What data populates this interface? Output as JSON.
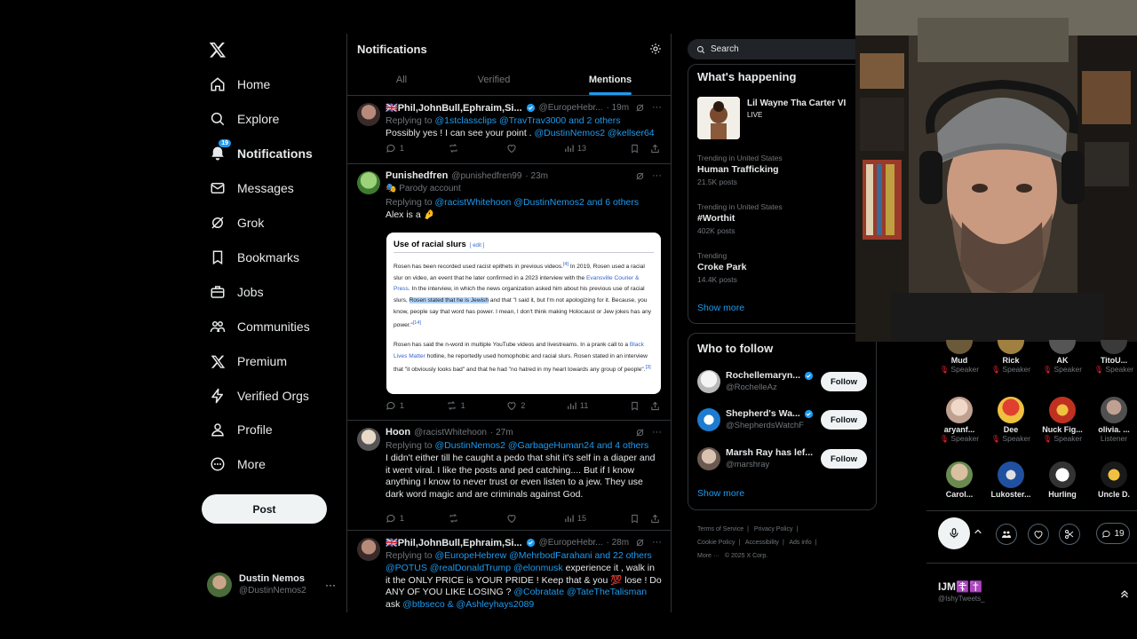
{
  "nav": {
    "items": [
      {
        "label": "Home",
        "icon": "home-icon"
      },
      {
        "label": "Explore",
        "icon": "search-icon"
      },
      {
        "label": "Notifications",
        "icon": "bell-icon",
        "badge": "19"
      },
      {
        "label": "Messages",
        "icon": "mail-icon"
      },
      {
        "label": "Grok",
        "icon": "grok-icon"
      },
      {
        "label": "Bookmarks",
        "icon": "bookmark-icon"
      },
      {
        "label": "Jobs",
        "icon": "briefcase-icon"
      },
      {
        "label": "Communities",
        "icon": "people-icon"
      },
      {
        "label": "Premium",
        "icon": "x-logo-icon"
      },
      {
        "label": "Verified Orgs",
        "icon": "lightning-icon"
      },
      {
        "label": "Profile",
        "icon": "person-icon"
      },
      {
        "label": "More",
        "icon": "more-circle-icon"
      }
    ],
    "post_label": "Post",
    "account": {
      "name": "Dustin Nemos",
      "handle": "@DustinNemos2"
    }
  },
  "center": {
    "title": "Notifications",
    "tabs": [
      "All",
      "Verified",
      "Mentions"
    ],
    "tweets": [
      {
        "name": "🇬🇧Phil,JohnBull,Ephraim,Si...",
        "handle": "@EuropeHebr...",
        "time": "· 19m",
        "replying_prefix": "Replying to",
        "replying_users": "@1stclassclips @TravTrav3000",
        "replying_suffix": "and 2 others",
        "text": "Possibly yes ! I can see your point .",
        "text_mentions": "@DustinNemos2 @kellser64",
        "replies": "1",
        "retweets": "",
        "likes": "",
        "views": "13"
      },
      {
        "name": "Punishedfren",
        "handle": "@punishedfren99",
        "time": "· 23m",
        "badge_label": "Parody account",
        "replying_prefix": "Replying to",
        "replying_users": "@racistWhitehoon @DustinNemos2",
        "replying_suffix": "and 6 others",
        "text": "Alex is a 🤌",
        "replies": "1",
        "retweets": "1",
        "likes": "2",
        "views": "11"
      },
      {
        "name": "Hoon",
        "handle": "@racistWhitehoon",
        "time": "· 27m",
        "replying_prefix": "Replying to",
        "replying_users": "@DustinNemos2 @GarbageHuman24",
        "replying_suffix": "and 4 others",
        "text": "I didn't either till he caught a pedo that shit it's self in a diaper and it went viral.  I like the posts and ped catching.... But if I know anything I know to never trust or even listen to a jew. They use dark word magic and are criminals against God.",
        "replies": "1",
        "retweets": "",
        "likes": "",
        "views": "15"
      },
      {
        "name": "🇬🇧Phil,JohnBull,Ephraim,Si...",
        "handle": "@EuropeHebr...",
        "time": "· 28m",
        "replying_prefix": "Replying to",
        "replying_users": "@EuropeHebrew @MehrbodFarahani",
        "replying_suffix": "and 22 others",
        "text_mentions_lead": "@POTUS @realDonaldTrump @elonmusk",
        "text": "experience it , walk in it the ONLY PRICE is YOUR PRIDE ! Keep that & you 💯 lose ! Do ANY OF YOU LIKE LOSING ?",
        "text_mentions": "@Cobratate @TateTheTalisman",
        "text_tail": "ask",
        "text_more": "@btbseco & @Ashleyhays2089"
      }
    ],
    "wiki": {
      "title": "Use of racial slurs",
      "edit": "[ edit ]",
      "p1_a": "Rosen has been recorded used racist epithets in previous videos.",
      "p1_ref1": "[4]",
      "p1_b": " In 2019, Rosen used a racial slur on video, an event that he later confirmed in a 2023 interview with the ",
      "p1_link": "Evansville Courier & Press",
      "p1_c": ". In the interview, in which the news organization asked him about his previous use of racial slurs, ",
      "p1_hl": "Rosen stated that he is Jewish",
      "p1_d": " and that \"I said it, but I'm not apologizing for it. Because, you know, people say that word has power. I mean, I don't think making Holocaust or Jew jokes has any power.\"",
      "p1_ref2": "[14]",
      "p2_a": "Rosen has said the n-word in multiple YouTube videos and livestreams. In a prank call to a ",
      "p2_link": "Black Lives Matter",
      "p2_b": " hotline, he reportedly used homophobic and racial slurs. Rosen stated in an interview that \"it obviously looks bad\" and that he had \"no hatred in my heart towards any group of people\".",
      "p2_ref": "[3]"
    }
  },
  "right": {
    "search_placeholder": "Search",
    "happening_title": "What's happening",
    "featured": {
      "name": "Lil Wayne Tha Carter VI",
      "status": "LIVE"
    },
    "trends": [
      {
        "meta": "Trending in United States",
        "name": "Human Trafficking",
        "posts": "21.5K posts"
      },
      {
        "meta": "Trending in United States",
        "name": "#Worthit",
        "posts": "402K posts"
      },
      {
        "meta": "Trending",
        "name": "Croke Park",
        "posts": "14.4K posts"
      }
    ],
    "show_more": "Show more",
    "wtf_title": "Who to follow",
    "wtf": [
      {
        "name": "Rochellemaryn...",
        "handle": "@RochelleAz",
        "button": "Follow",
        "verified": true
      },
      {
        "name": "Shepherd's Wa...",
        "handle": "@ShepherdsWatchF",
        "button": "Follow",
        "verified": true
      },
      {
        "name": "Marsh Ray has lef...",
        "handle": "@marshray",
        "button": "Follow",
        "verified": false
      }
    ],
    "footer": [
      "Terms of Service",
      "|",
      "Privacy Policy",
      "|",
      "Cookie Policy",
      "|",
      "Accessibility",
      "|",
      "Ads info",
      "|",
      "More ···",
      "© 2025 X Corp."
    ]
  },
  "spaces": {
    "row1": [
      {
        "name": "Mud",
        "role": "Speaker"
      },
      {
        "name": "Rick",
        "role": "Speaker"
      },
      {
        "name": "AK",
        "role": "Speaker"
      },
      {
        "name": "TitoU...",
        "role": "Speaker"
      }
    ],
    "row2": [
      {
        "name": "aryanf...",
        "role": "Speaker"
      },
      {
        "name": "Dee",
        "role": "Speaker"
      },
      {
        "name": "Nuck Fig...",
        "role": "Speaker"
      },
      {
        "name": "olivia. ...",
        "role": "Listener"
      }
    ],
    "row3": [
      {
        "name": "Carol...",
        "role": ""
      },
      {
        "name": "Lukoster...",
        "role": ""
      },
      {
        "name": "Hurling",
        "role": ""
      },
      {
        "name": "Uncle D.",
        "role": ""
      }
    ],
    "comment_count": "19",
    "host_name": "IJM☦️✝️",
    "host_handle": "@IshyTweets_"
  },
  "colors": {
    "accent": "#1d9bf0",
    "background": "#000000",
    "border": "#2f3336",
    "muted": "#71767b",
    "like_red": "#f4212e"
  }
}
